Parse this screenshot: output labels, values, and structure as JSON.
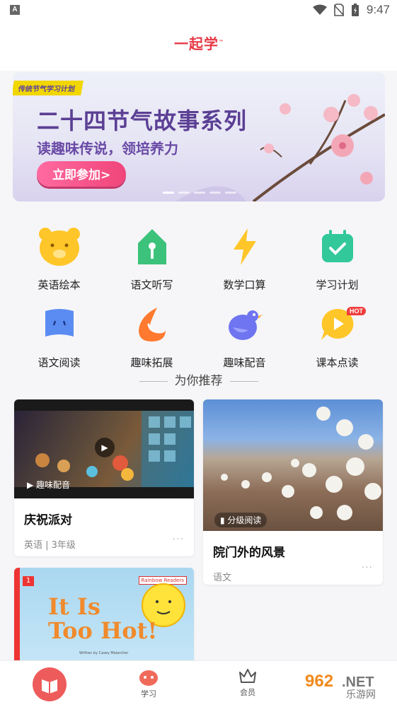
{
  "status_bar": {
    "keyboard_indicator": "A",
    "time": "9:47"
  },
  "header": {
    "logo": "一起学",
    "logo_tm": "™"
  },
  "banner": {
    "tag": "传统节气学习计划",
    "title": "二十四节气故事系列",
    "subtitle": "读趣味传说，领培养力",
    "button": "立即参加>"
  },
  "menu": [
    {
      "label": "英语绘本",
      "icon": "bear-icon",
      "color": "#ffc629"
    },
    {
      "label": "语文听写",
      "icon": "pen-icon",
      "color": "#3cc27a"
    },
    {
      "label": "数学口算",
      "icon": "lightning-icon",
      "color": "#ffc629"
    },
    {
      "label": "学习计划",
      "icon": "calendar-check-icon",
      "color": "#32c89a"
    },
    {
      "label": "语文阅读",
      "icon": "book-icon",
      "color": "#5b8cf2"
    },
    {
      "label": "趣味拓展",
      "icon": "flame-icon",
      "color": "#ff7a2e"
    },
    {
      "label": "趣味配音",
      "icon": "bird-icon",
      "color": "#6f74f0"
    },
    {
      "label": "课本点读",
      "icon": "play-bubble-icon",
      "color": "#ffc629",
      "badge": "HOT"
    }
  ],
  "recommend": {
    "title": "为你推荐",
    "cards": [
      {
        "badge": "趣味配音",
        "title": "庆祝派对",
        "meta": "英语 | 3年级",
        "more": "···"
      },
      {
        "badge": "分级阅读",
        "title": "院门外的风景",
        "meta": "语文",
        "more": "···"
      },
      {
        "book_title_line1": "It Is",
        "book_title_line2": "Too Hot!",
        "book_number": "1",
        "book_series": "Rainbow Readers",
        "book_credit": "Written by Casey Malarcher"
      }
    ]
  },
  "tabbar": {
    "home": "",
    "study": "学习",
    "member": "会员"
  },
  "watermark": {
    "text1": "962",
    "text2": ".NET",
    "text3": "乐游网"
  }
}
